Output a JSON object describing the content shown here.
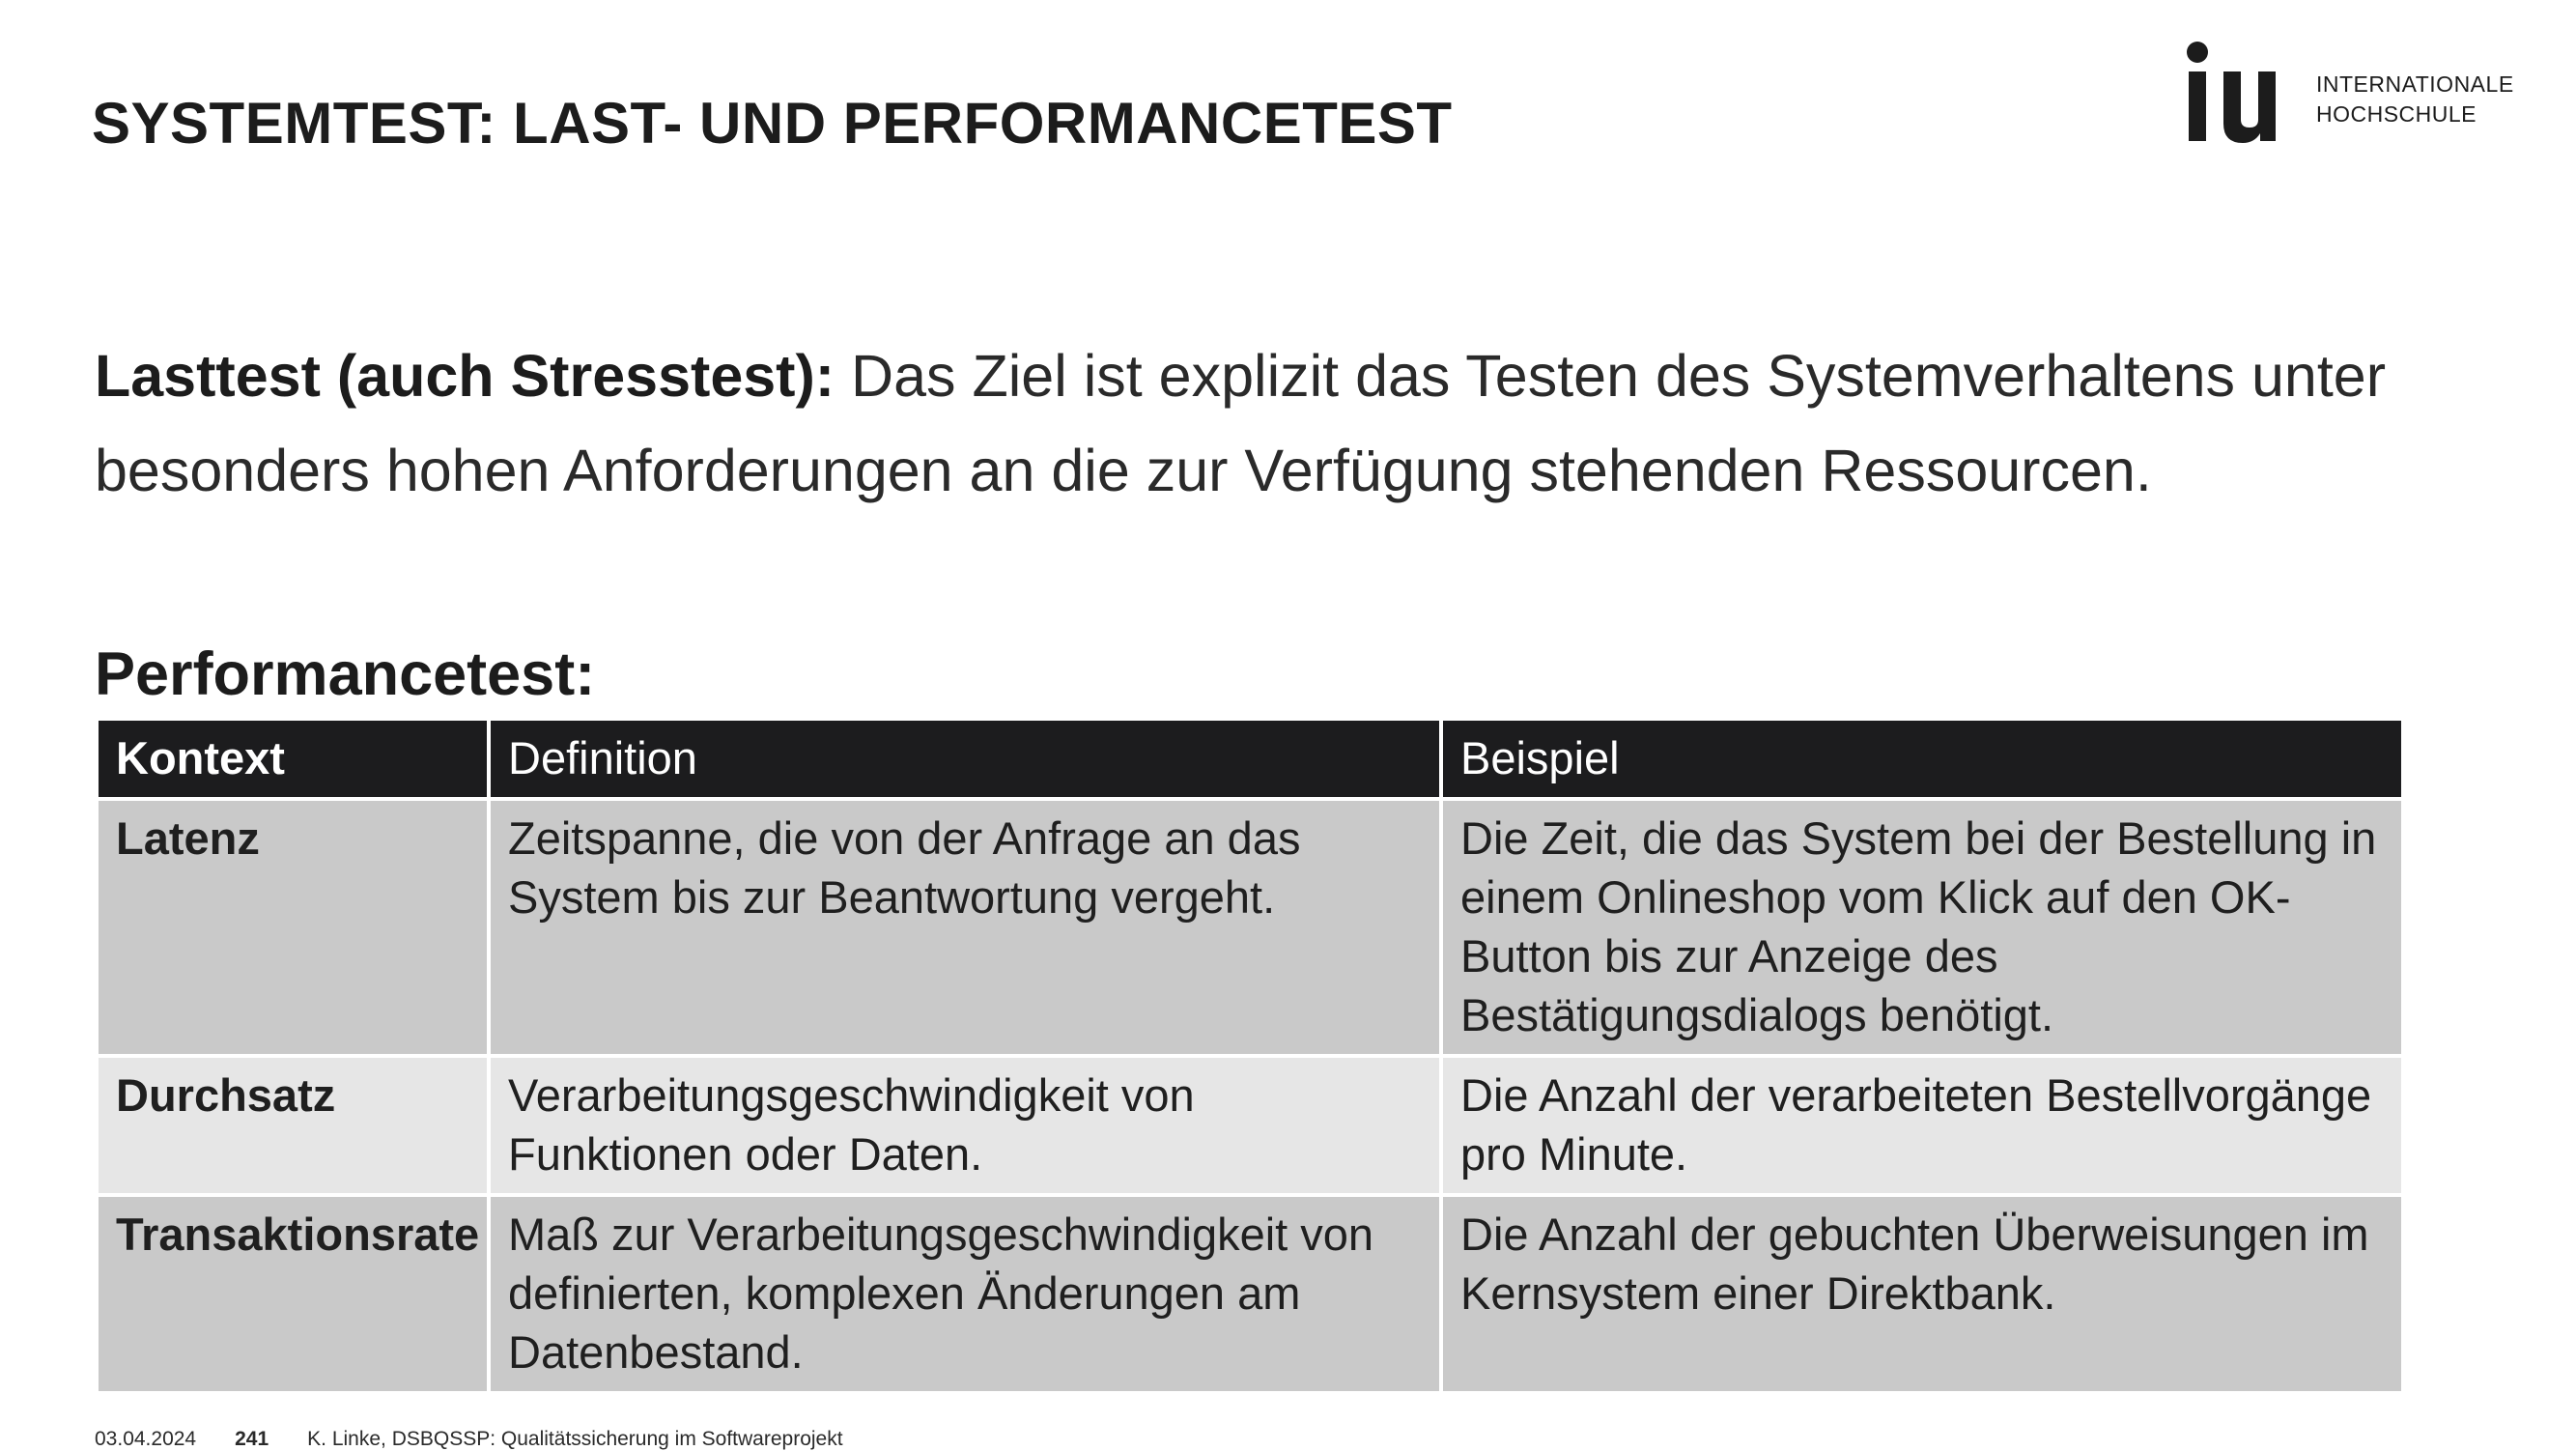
{
  "slide": {
    "title": "SYSTEMTEST: LAST- UND PERFORMANCETEST"
  },
  "logo": {
    "mark": "iu",
    "line1": "INTERNATIONALE",
    "line2": "HOCHSCHULE"
  },
  "intro": {
    "term": "Lasttest (auch Stresstest):",
    "text": " Das Ziel ist explizit das Testen des Systemverhaltens unter besonders hohen Anforderungen an die zur Verfügung stehenden Ressourcen."
  },
  "performance": {
    "heading": "Performancetest:",
    "columns": [
      "Kontext",
      "Definition",
      "Beispiel"
    ],
    "rows": [
      {
        "kontext": "Latenz",
        "definition": "Zeitspanne, die von der Anfrage an das System bis zur Beantwortung vergeht.",
        "beispiel": "Die Zeit, die das System bei der Bestellung in einem Onlineshop vom Klick auf den OK-Button bis zur Anzeige des Bestätigungsdialogs benötigt."
      },
      {
        "kontext": "Durchsatz",
        "definition": "Verarbeitungsgeschwindigkeit von Funktionen oder Daten.",
        "beispiel": "Die Anzahl der verarbeiteten Bestellvorgänge pro Minute."
      },
      {
        "kontext": "Transaktionsrate",
        "definition": "Maß zur Verarbeitungsgeschwindigkeit von definierten, komplexen Änderungen am Datenbestand.",
        "beispiel": "Die Anzahl der gebuchten Überweisungen im Kernsystem einer Direktbank."
      }
    ]
  },
  "footer": {
    "date": "03.04.2024",
    "page": "241",
    "author": "K. Linke, DSBQSSP: Qualitätssicherung im Softwareprojekt"
  },
  "colors": {
    "header_bg": "#1c1c1e",
    "row_dark": "#c9c9c9",
    "row_light": "#e6e6e6"
  }
}
